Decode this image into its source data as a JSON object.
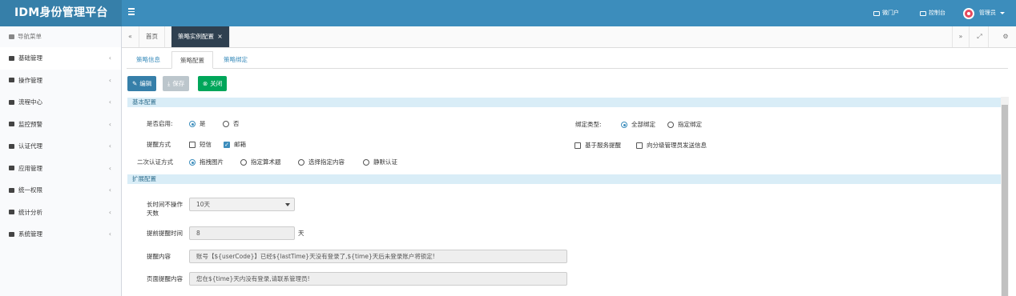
{
  "app": {
    "title": "IDM身份管理平台"
  },
  "header": {
    "portal": "微门户",
    "console": "控制台",
    "user": "管理员"
  },
  "sidebar": {
    "title": "导航菜单",
    "items": [
      {
        "label": "基础管理"
      },
      {
        "label": "操作管理"
      },
      {
        "label": "流程中心"
      },
      {
        "label": "监控预警"
      },
      {
        "label": "认证代理"
      },
      {
        "label": "应用管理"
      },
      {
        "label": "统一权限"
      },
      {
        "label": "统计分析"
      },
      {
        "label": "系统管理"
      }
    ]
  },
  "tabs": {
    "home": "首页",
    "active": "策略实例配置"
  },
  "subtabs": {
    "info": "策略信息",
    "config": "策略配置",
    "bind": "策略绑定"
  },
  "toolbar": {
    "edit": "编辑",
    "save": "保存",
    "close": "关闭"
  },
  "basic": {
    "section": "基本配置",
    "enabled_label": "是否启用:",
    "enabled_yes": "是",
    "enabled_no": "否",
    "bind_type_label": "绑定类型:",
    "bind_all": "全部绑定",
    "bind_specified": "指定绑定",
    "remind_label": "提醒方式",
    "remind_sms": "短信",
    "remind_email": "邮箱",
    "remind_service": "基于服务提醒",
    "remind_admin": "向分级管理员发送信息",
    "auth_label": "二次认证方式",
    "auth_drag": "拖拽图片",
    "auth_math": "指定算术题",
    "auth_content": "选择指定内容",
    "auth_silent": "静默认证"
  },
  "extended": {
    "section": "扩展配置",
    "idle_label_1": "长时间不操作",
    "idle_label_2": "天数",
    "idle_value": "10天",
    "advance_label": "提前提醒时间",
    "advance_value": "8",
    "advance_unit": "天",
    "content_label": "提醒内容",
    "content_value": "账号【${userCode}】已经${lastTime}天没有登录了,${time}天后未登录账户将锁定!",
    "page_label": "页面提醒内容",
    "page_value": "您在${time}天内没有登录,请联系管理员!"
  }
}
